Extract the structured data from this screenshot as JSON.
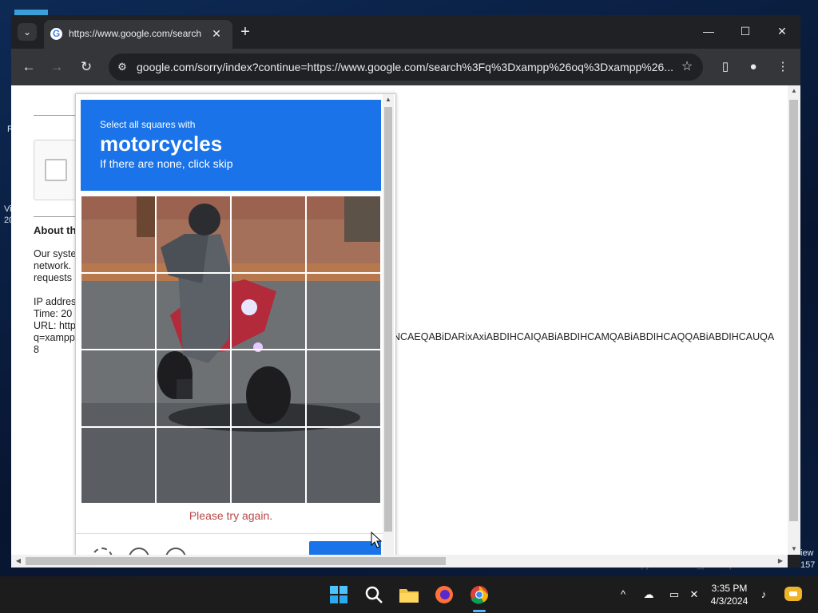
{
  "desktop": {
    "left_fragments": [
      "R",
      "Vi",
      "20"
    ],
    "right_fragments": [
      "iew",
      "157"
    ],
    "bottom_text": "Screenshot copy Screenshot_paradeplatz"
  },
  "browser": {
    "tab_dropdown_icon": "chevron-down-icon",
    "tab_title": "https://www.google.com/search",
    "new_tab_label": "+",
    "url": "google.com/sorry/index?continue=https://www.google.com/search%3Fq%3Dxampp%26oq%3Dxampp%26...",
    "window_controls": {
      "minimize": "—",
      "maximize": "☐",
      "close": "✕"
    }
  },
  "page": {
    "about_heading": "About th",
    "body_lines": [
      "Our syste",
      "network.",
      "requests"
    ],
    "info_lines": [
      "IP addres",
      "Time: 20",
      "URL: http",
      "q=xampp",
      "8"
    ],
    "long_url_tail": "NCAEQABiDARixAxiABDIHCAIQABiABDIHCAMQABiABDIHCAQQABiABDIHCAUQA"
  },
  "captcha": {
    "instruction": "Select all squares with",
    "target": "motorcycles",
    "hint": "If there are none, click skip",
    "error": "Please try again.",
    "grid_rows": 4,
    "grid_cols": 4,
    "colors": {
      "header": "#1a73e8",
      "error": "#b94a48"
    }
  },
  "taskbar": {
    "apps": [
      "windows-start",
      "search",
      "file-explorer",
      "firefox",
      "chrome"
    ],
    "active_app": "chrome",
    "time": "3:35 PM",
    "date": "4/3/2024"
  }
}
